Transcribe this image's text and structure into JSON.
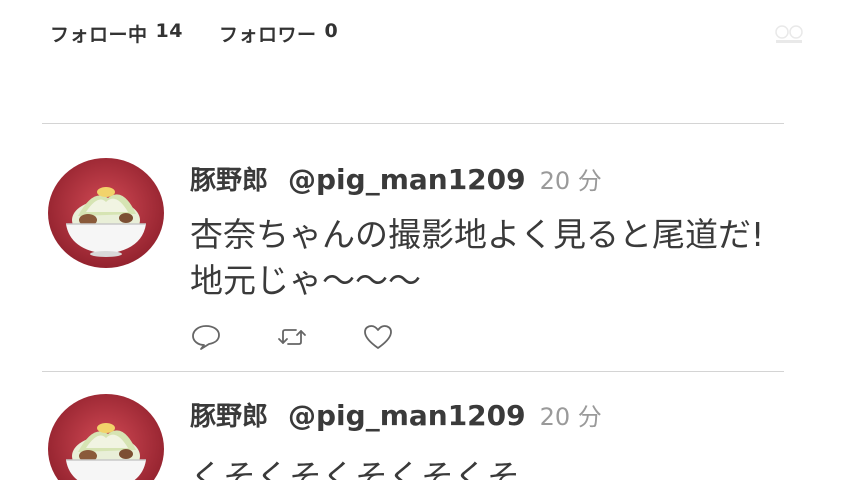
{
  "profile": {
    "following_label": "フォロー中",
    "following_count": "14",
    "followers_label": "フォロワー",
    "followers_count": "0"
  },
  "tweets": [
    {
      "display_name": "豚野郎",
      "handle": "@pig_man1209",
      "time": "20 分",
      "text_line1": "杏奈ちゃんの撮影地よく見ると尾道だ!",
      "text_line2": "地元じゃ〜〜〜"
    },
    {
      "display_name": "豚野郎",
      "handle": "@pig_man1209",
      "time": "20 分",
      "text_line1": "くそくそくそくそくそ"
    }
  ],
  "icons": {
    "reply": "reply-icon",
    "retweet": "retweet-icon",
    "like": "heart-icon"
  },
  "colors": {
    "text": "#3a3a3a",
    "muted": "#9a9a9a",
    "divider": "#d4d4d4",
    "avatar_bg": "#b02a38"
  }
}
